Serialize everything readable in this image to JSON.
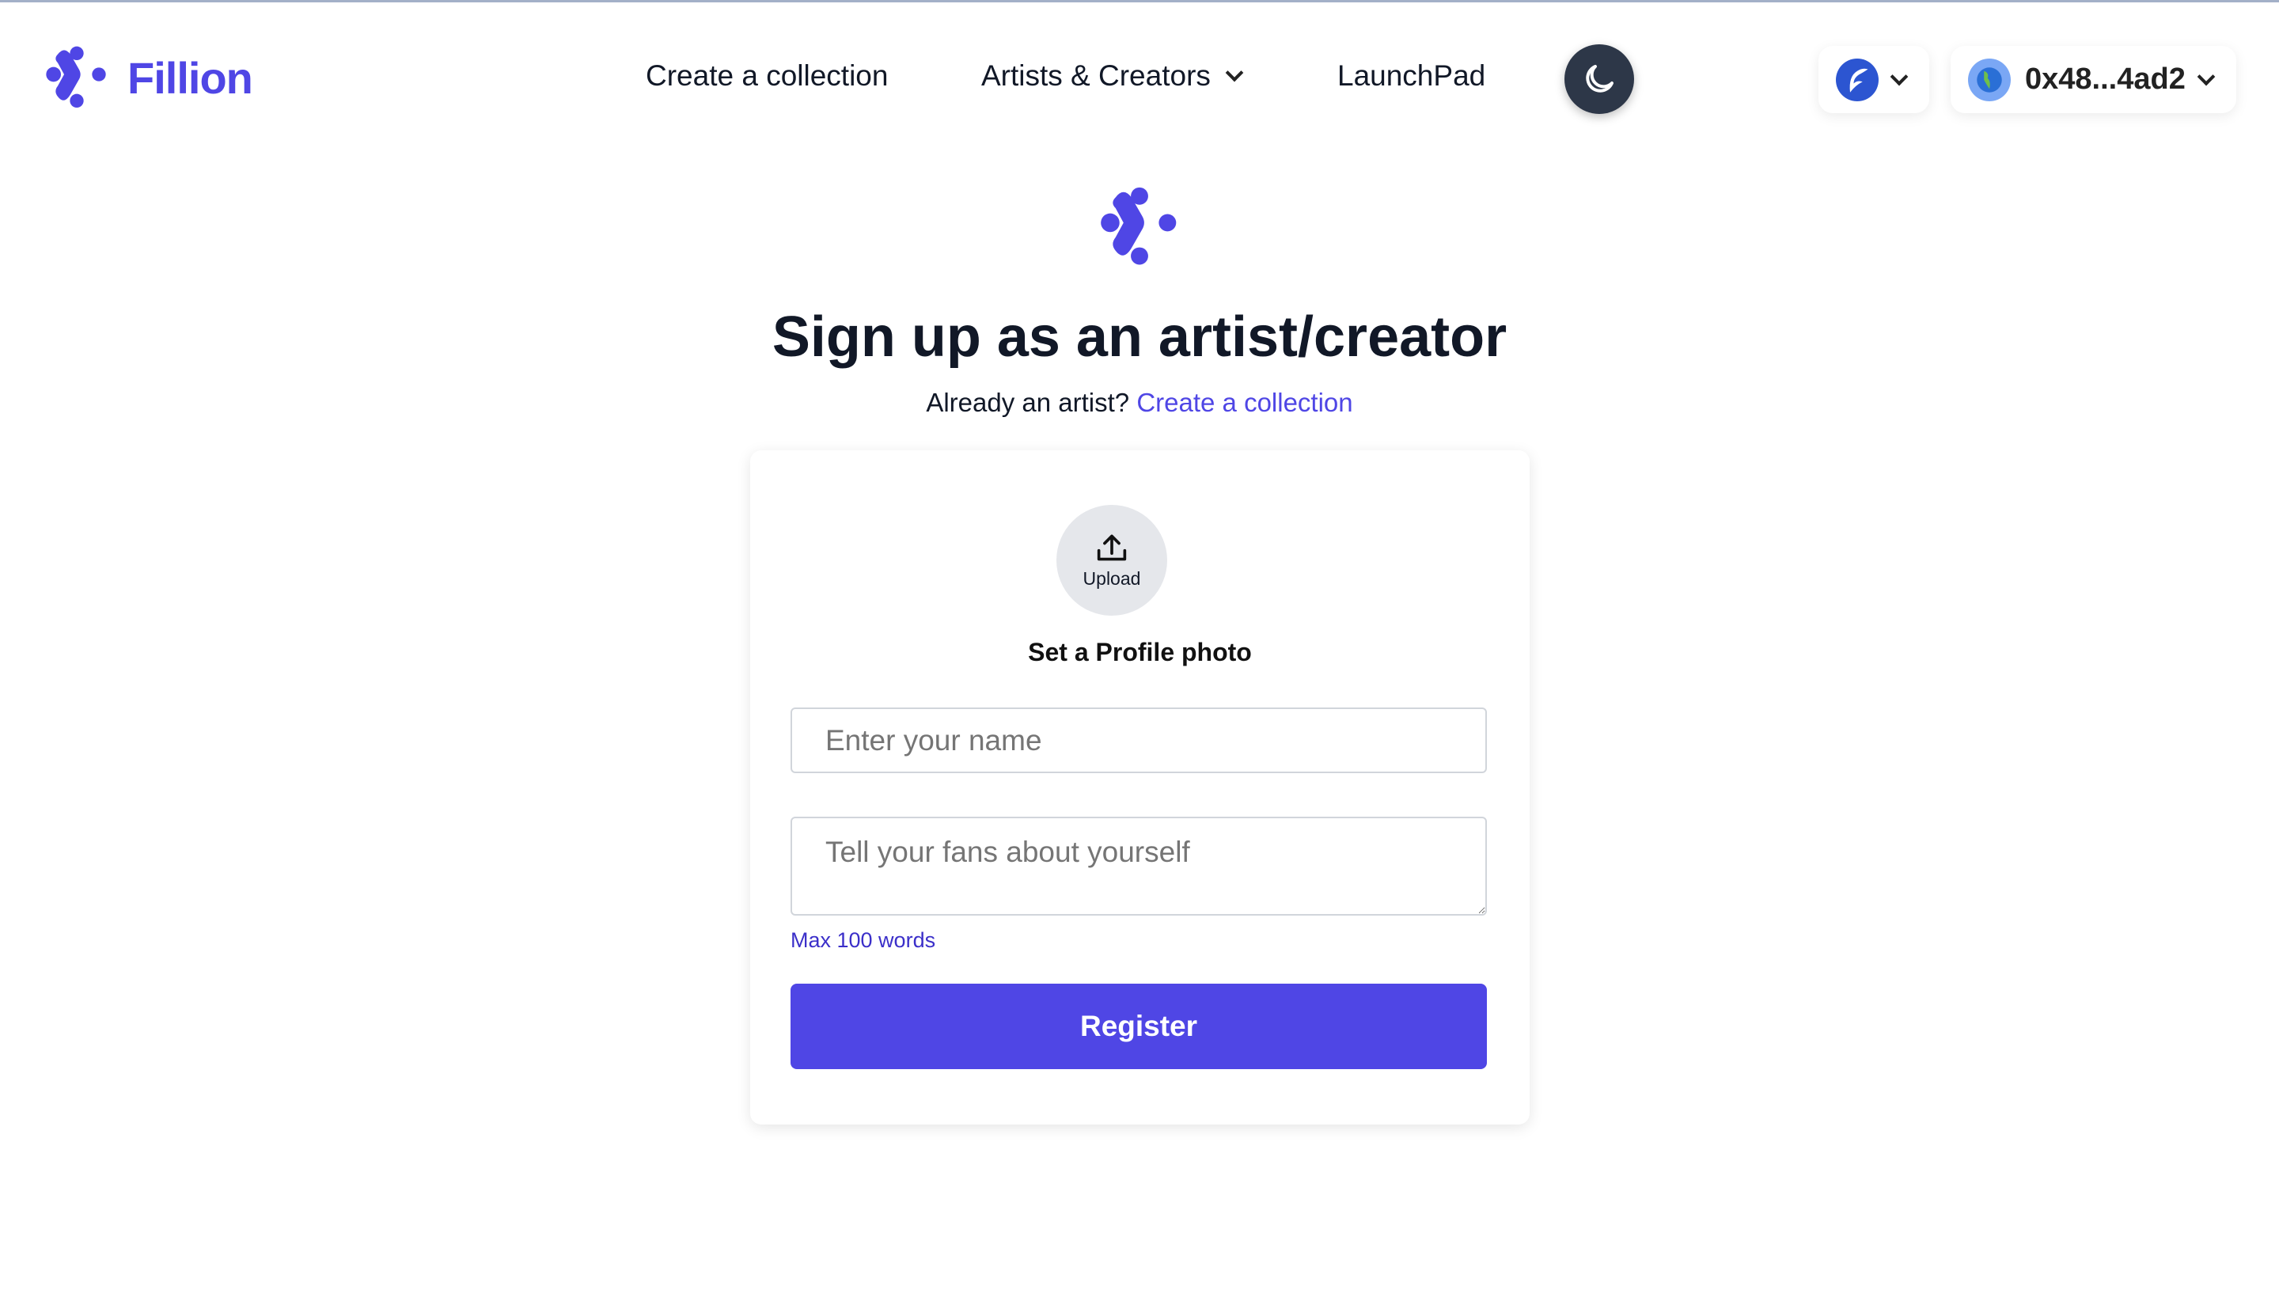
{
  "header": {
    "brand": "Fillion",
    "nav": [
      {
        "label": "Create a collection"
      },
      {
        "label": "Artists & Creators"
      },
      {
        "label": "LaunchPad"
      }
    ],
    "theme_toggle_icon": "moon-icon",
    "wallet": {
      "address": "0x48...4ad2"
    }
  },
  "main": {
    "title": "Sign up as an artist/creator",
    "subtitle_prefix": "Already an artist?",
    "subtitle_link": "Create a collection",
    "upload_label": "Upload",
    "profile_photo_label": "Set a Profile photo",
    "name_placeholder": "Enter your name",
    "bio_placeholder": "Tell your fans about yourself",
    "bio_hint": "Max 100 words",
    "register_label": "Register"
  },
  "colors": {
    "accent": "#4f46e5",
    "dark_toggle": "#2d3748"
  }
}
